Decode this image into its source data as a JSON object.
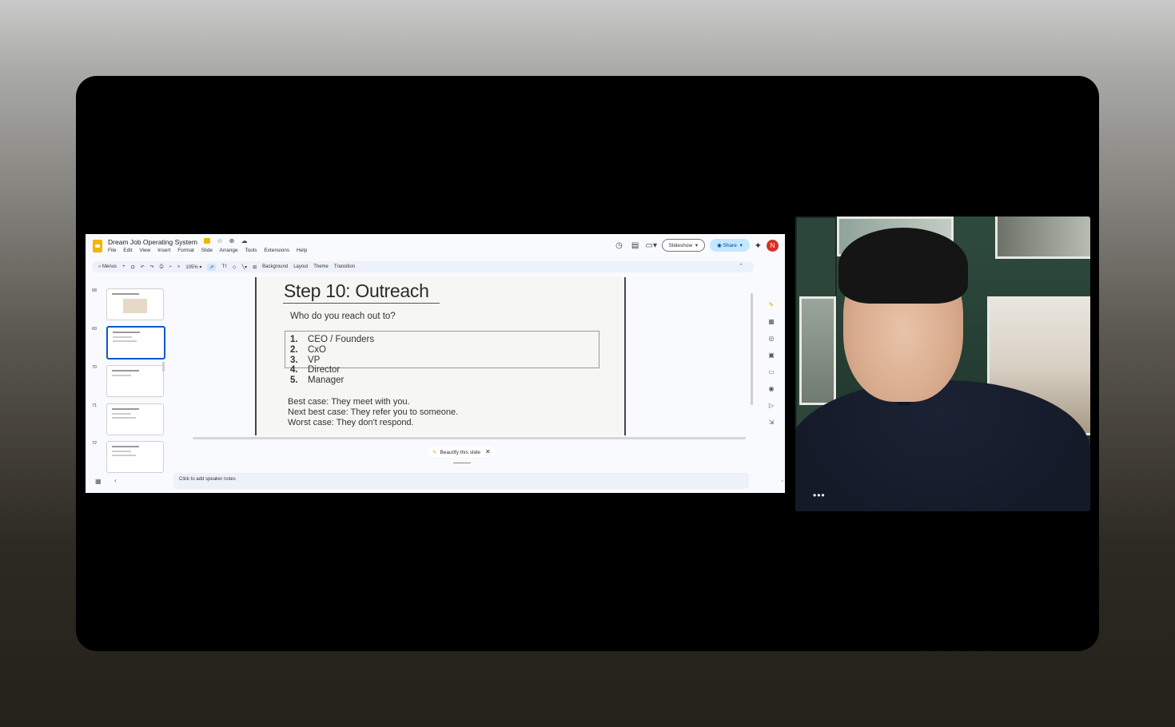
{
  "app": {
    "doc_title": "Dream Job Operating System",
    "menu": [
      "File",
      "Edit",
      "View",
      "Insert",
      "Format",
      "Slide",
      "Arrange",
      "Tools",
      "Extensions",
      "Help"
    ],
    "slideshow_label": "Slideshow",
    "share_label": "Share",
    "avatar_initial": "N"
  },
  "toolbar": {
    "menus_label": "Menus",
    "zoom": "105%",
    "background_label": "Background",
    "layout_label": "Layout",
    "theme_label": "Theme",
    "transition_label": "Transition"
  },
  "filmstrip": [
    {
      "num": "68",
      "active": false
    },
    {
      "num": "69",
      "active": true
    },
    {
      "num": "70",
      "active": false
    },
    {
      "num": "71",
      "active": false
    },
    {
      "num": "72",
      "active": false
    }
  ],
  "slide": {
    "title": "Step 10:  Outreach",
    "subtitle": "Who do you reach out to?",
    "list": [
      {
        "n": "1.",
        "text": "CEO / Founders"
      },
      {
        "n": "2.",
        "text": "CxO"
      },
      {
        "n": "3.",
        "text": "VP"
      },
      {
        "n": "4.",
        "text": "Director"
      },
      {
        "n": "5.",
        "text": "Manager"
      }
    ],
    "cases": [
      "Best case:  They meet with you.",
      "Next best case:  They refer you to someone.",
      "Worst case:  They don't respond."
    ]
  },
  "beautify_label": "Beautify this slide",
  "notes_placeholder": "Click to add speaker notes",
  "colors": {
    "accent": "#0b57d0",
    "share_bg": "#c2e7ff",
    "avatar": "#d93025",
    "slides_logo": "#f4b400"
  }
}
